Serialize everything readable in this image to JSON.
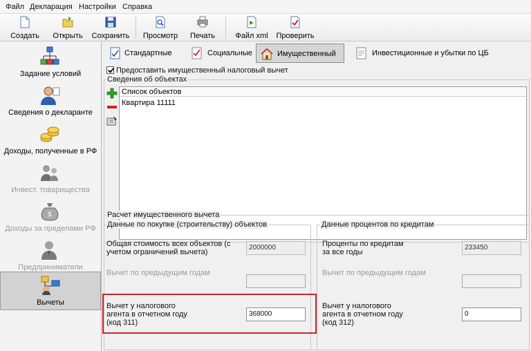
{
  "menu": {
    "items": [
      "Файл",
      "Декларация",
      "Настройки",
      "Справка"
    ]
  },
  "toolbar": {
    "buttons": [
      {
        "label": "Создать",
        "icon": "new-document-icon"
      },
      {
        "label": "Открыть",
        "icon": "open-folder-icon"
      },
      {
        "label": "Сохранить",
        "icon": "save-disk-icon"
      },
      {
        "label": "Просмотр",
        "icon": "preview-icon"
      },
      {
        "label": "Печать",
        "icon": "printer-icon"
      },
      {
        "label": "Файл xml",
        "icon": "xml-file-icon"
      },
      {
        "label": "Проверить",
        "icon": "check-document-icon"
      }
    ]
  },
  "sidebar": {
    "items": [
      {
        "label": "Задание условий",
        "icon": "hierarchy-icon",
        "disabled": false,
        "selected": false
      },
      {
        "label": "Сведения о декларанте",
        "icon": "person-icon",
        "disabled": false,
        "selected": false
      },
      {
        "label": "Доходы, полученные в РФ",
        "icon": "coins-icon",
        "disabled": false,
        "selected": false
      },
      {
        "label": "Инвест. товарищества",
        "icon": "partners-icon",
        "disabled": true,
        "selected": false
      },
      {
        "label": "Доходы за пределами РФ",
        "icon": "money-bag-icon",
        "disabled": true,
        "selected": false
      },
      {
        "label": "Предприниматели",
        "icon": "businessman-icon",
        "disabled": true,
        "selected": false
      },
      {
        "label": "Вычеты",
        "icon": "deductions-icon",
        "disabled": false,
        "selected": true
      }
    ]
  },
  "tabs": [
    {
      "label": "Стандартные",
      "icon": "standard-tab-icon",
      "active": false
    },
    {
      "label": "Социальные",
      "icon": "social-tab-icon",
      "active": false
    },
    {
      "label": "Имущественный",
      "icon": "house-icon",
      "active": true
    },
    {
      "label": "Инвестиционные и убытки по ЦБ",
      "icon": "investment-tab-icon",
      "active": false
    }
  ],
  "property": {
    "checkbox_label": "Предоставить имущественный налоговый вычет",
    "checked": true,
    "objects_group_title": "Сведения об объектах",
    "list_header": "Список объектов",
    "objects": [
      "Квартира 11111"
    ]
  },
  "calc": {
    "title": "Расчет имущественного вычета",
    "purchase": {
      "title": "Данные по покупке (строительству) объектов",
      "total_cost_label": "Общая стоимость всех объектов (с учетом ограничений вычета)",
      "total_cost_value": "2000000",
      "prev_years_label": "Вычет по предыдущим годам",
      "prev_years_value": "",
      "agent_label_1": "Вычет у налогового",
      "agent_label_2": "агента в отчетном году",
      "agent_label_3": "(код 311)",
      "agent_value": "368000"
    },
    "interest": {
      "title": "Данные процентов по кредитам",
      "total_label_1": "Проценты по кредитам",
      "total_label_2": "за все годы",
      "total_value": "233450",
      "prev_years_label": "Вычет по предыдущим годам",
      "prev_years_value": "",
      "agent_label_1": "Вычет у налогового",
      "agent_label_2": "агента в отчетном году",
      "agent_label_3": "(код 312)",
      "agent_value": "0"
    }
  },
  "colors": {
    "highlight": "#c8262b",
    "selected_nav_bg": "#d2d2d2",
    "add_green": "#2f9e2f",
    "remove_red": "#cc2222"
  }
}
